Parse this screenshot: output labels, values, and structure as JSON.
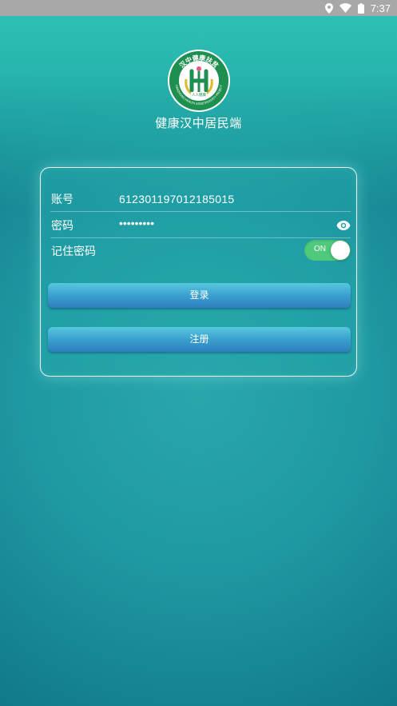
{
  "status_bar": {
    "time": "7:37",
    "icons": [
      "location-icon",
      "wifi-icon",
      "battery-icon"
    ]
  },
  "logo": {
    "arc_text": "汉中健康扶贫",
    "lower_arc_text": "HANZHONG HEALTH ASSISTPOVERTY PROJECT",
    "center_label": "人人健康"
  },
  "app": {
    "name": "健康汉中居民端"
  },
  "form": {
    "account_label": "账号",
    "account_value": "612301197012185015",
    "password_label": "密码",
    "password_value": "•••••••••",
    "remember_label": "记住密码",
    "remember_toggle_text": "ON",
    "remember_on": true
  },
  "actions": {
    "login_label": "登录",
    "register_label": "注册"
  },
  "colors": {
    "status_bar": "#a8a8a8",
    "toggle_on": "#4fc97a",
    "button_top": "#58c7de",
    "button_bottom": "#2f7fbd",
    "logo_green": "#1e8f4e"
  }
}
